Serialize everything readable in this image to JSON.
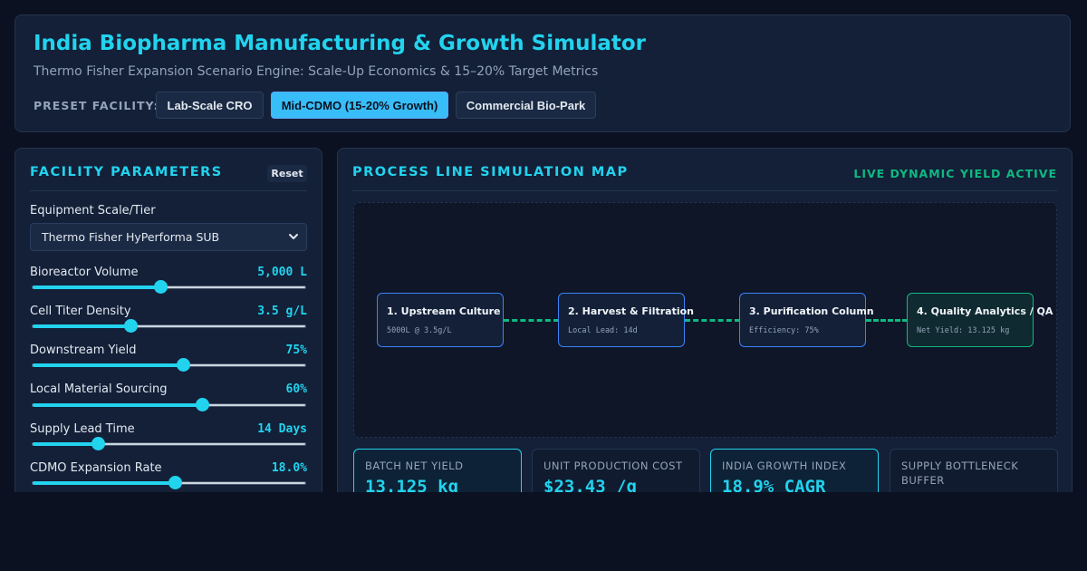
{
  "header": {
    "title": "India Biopharma Manufacturing & Growth Simulator",
    "subtitle": "Thermo Fisher Expansion Scenario Engine: Scale-Up Economics & 15–20% Target Metrics",
    "preset_label": "PRESET FACILITY:",
    "presets": [
      {
        "label": "Lab-Scale CRO",
        "active": false
      },
      {
        "label": "Mid-CDMO (15-20% Growth)",
        "active": true
      },
      {
        "label": "Commercial Bio-Park",
        "active": false
      }
    ]
  },
  "params": {
    "title": "FACILITY PARAMETERS",
    "reset_label": "Reset",
    "equipment_label": "Equipment Scale/Tier",
    "equipment_value": "Thermo Fisher HyPerforma SUB",
    "sliders": [
      {
        "label": "Bioreactor Volume",
        "value": "5,000 L",
        "fraction": 0.47
      },
      {
        "label": "Cell Titer Density",
        "value": "3.5 g/L",
        "fraction": 0.36
      },
      {
        "label": "Downstream Yield",
        "value": "75%",
        "fraction": 0.55
      },
      {
        "label": "Local Material Sourcing",
        "value": "60%",
        "fraction": 0.62
      },
      {
        "label": "Supply Lead Time",
        "value": "14 Days",
        "fraction": 0.24
      },
      {
        "label": "CDMO Expansion Rate",
        "value": "18.0%",
        "fraction": 0.52
      }
    ]
  },
  "process": {
    "title": "PROCESS LINE SIMULATION MAP",
    "status": "LIVE DYNAMIC YIELD ACTIVE",
    "nodes": [
      {
        "title": "1. Upstream Culture",
        "sub": "5000L @ 3.5g/L"
      },
      {
        "title": "2. Harvest & Filtration",
        "sub": "Local Lead: 14d"
      },
      {
        "title": "3. Purification Column",
        "sub": "Efficiency: 75%"
      },
      {
        "title": "4. Quality Analytics / QA",
        "sub": "Net Yield: 13.125 kg"
      }
    ]
  },
  "metrics": [
    {
      "label": "BATCH NET YIELD",
      "value": "13.125 kg"
    },
    {
      "label": "UNIT PRODUCTION COST",
      "value": "$23.43 /g"
    },
    {
      "label": "INDIA GROWTH INDEX",
      "value": "18.9% CAGR"
    },
    {
      "label": "SUPPLY BOTTLENECK BUFFER",
      "value": ""
    }
  ],
  "colors": {
    "accent": "#22d3ee",
    "success": "#10b981",
    "background": "#0b1120",
    "panel": "#132038"
  }
}
